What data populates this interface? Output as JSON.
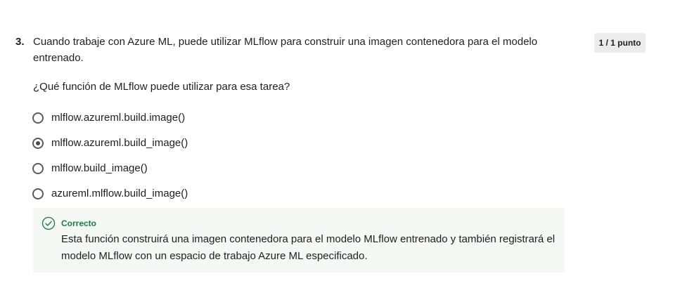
{
  "question": {
    "number": "3.",
    "text": "Cuando trabaje con Azure ML, puede utilizar MLflow para construir una imagen contenedora para el modelo entrenado.",
    "subquestion": "¿Qué función de MLflow puede utilizar para esa tarea?",
    "points": "1 / 1 punto"
  },
  "options": [
    {
      "label": "mlflow.azureml.build.image()",
      "selected": false
    },
    {
      "label": "mlflow.azureml.build_image()",
      "selected": true
    },
    {
      "label": "mlflow.build_image()",
      "selected": false
    },
    {
      "label": "azureml.mlflow.build_image()",
      "selected": false
    }
  ],
  "feedback": {
    "status": "Correcto",
    "text": "Esta función construirá una imagen contenedora para el modelo MLflow entrenado y también registrará el modelo MLflow con un espacio de trabajo Azure ML especificado.",
    "icon": "check-circle-icon",
    "accent_color": "#1d7a45"
  }
}
